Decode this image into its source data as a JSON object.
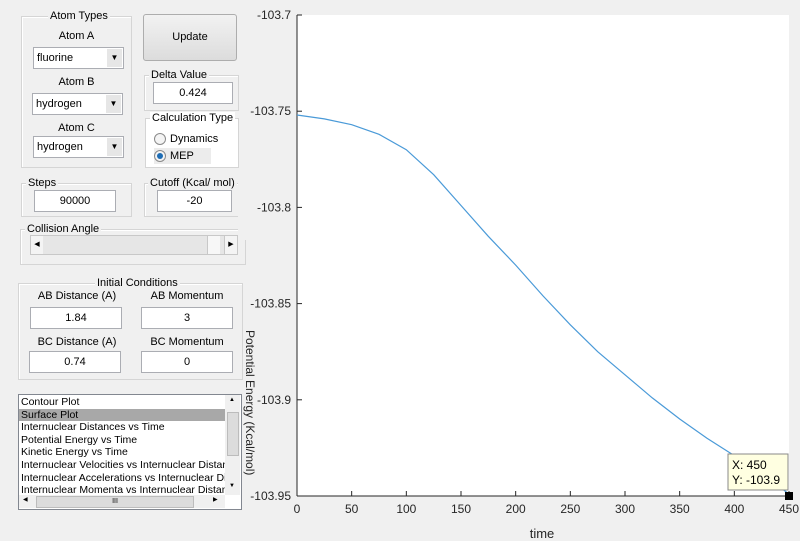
{
  "atom_types": {
    "title": "Atom Types",
    "atom_a": {
      "label": "Atom A",
      "value": "fluorine"
    },
    "atom_b": {
      "label": "Atom B",
      "value": "hydrogen"
    },
    "atom_c": {
      "label": "Atom C",
      "value": "hydrogen"
    }
  },
  "update_label": "Update",
  "delta": {
    "title": "Delta Value",
    "value": "0.424"
  },
  "calc_type": {
    "title": "Calculation Type",
    "options": [
      "Dynamics",
      "MEP"
    ],
    "selected": "MEP"
  },
  "steps": {
    "title": "Steps",
    "value": "90000"
  },
  "cutoff": {
    "title": "Cutoff (Kcal/ mol)",
    "value": "-20"
  },
  "collision": {
    "title": "Collision Angle",
    "slider_fraction": 0.95
  },
  "initial": {
    "title": "Initial Conditions",
    "ab_dist": {
      "label": "AB Distance (A)",
      "value": "1.84"
    },
    "ab_mom": {
      "label": "AB Momentum",
      "value": "3"
    },
    "bc_dist": {
      "label": "BC Distance (A)",
      "value": "0.74"
    },
    "bc_mom": {
      "label": "BC Momentum",
      "value": "0"
    }
  },
  "plot_list": {
    "items": [
      "Contour Plot",
      "Surface Plot",
      "Internuclear Distances vs Time",
      "Potential Energy vs Time",
      "Kinetic Energy vs Time",
      "Internuclear Velocities vs Internuclear Distance",
      "Internuclear Accelerations vs Internuclear Distance",
      "Internuclear Momenta vs Internuclear Distance"
    ],
    "selected": "Surface Plot",
    "hscroll_glyph": "III"
  },
  "chart_data": {
    "type": "line",
    "xlabel": "time",
    "ylabel": "Potential Energy (Kcal/mol)",
    "xlim": [
      0,
      450
    ],
    "ylim": [
      -103.95,
      -103.7
    ],
    "xticks": [
      "0",
      "50",
      "100",
      "150",
      "200",
      "250",
      "300",
      "350",
      "400",
      "450"
    ],
    "yticks": [
      "-103.7",
      "-103.75",
      "-103.8",
      "-103.85",
      "-103.9",
      "-103.95"
    ],
    "x": [
      0,
      25,
      50,
      75,
      100,
      125,
      150,
      175,
      200,
      225,
      250,
      275,
      300,
      325,
      350,
      375,
      400,
      425,
      450
    ],
    "y": [
      -103.752,
      -103.754,
      -103.757,
      -103.762,
      -103.77,
      -103.783,
      -103.799,
      -103.815,
      -103.83,
      -103.846,
      -103.861,
      -103.875,
      -103.887,
      -103.899,
      -103.91,
      -103.92,
      -103.929,
      -103.938,
      -103.949
    ],
    "color": "#4a9ad8",
    "datatip": {
      "x_text": "X: 450",
      "y_text": "Y: -103.9"
    }
  }
}
